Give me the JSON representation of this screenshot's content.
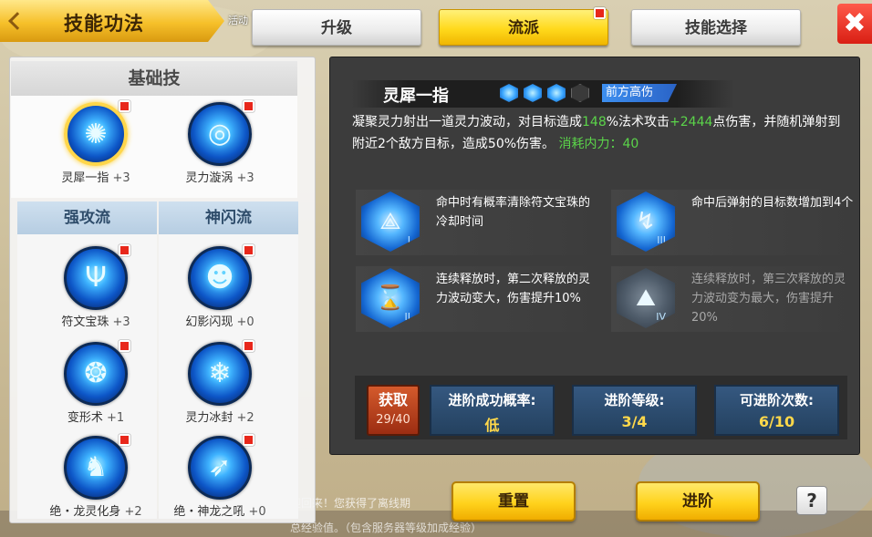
{
  "header": {
    "title": "技能功法",
    "activity_label": "活动"
  },
  "tabs": [
    {
      "label": "升级",
      "active": false
    },
    {
      "label": "流派",
      "active": true
    },
    {
      "label": "技能选择",
      "active": false
    }
  ],
  "close_glyph": "✖",
  "left": {
    "basic_header": "基础技",
    "basic_skills": [
      {
        "name": "灵犀一指",
        "level": "+3",
        "icon": "energy-orb-icon",
        "selected": true
      },
      {
        "name": "灵力漩涡",
        "level": "+3",
        "icon": "vortex-icon",
        "selected": false
      }
    ],
    "schools": [
      {
        "name": "强攻流",
        "skills": [
          {
            "name": "符文宝珠",
            "level": "+3",
            "icon": "rune-orb-icon"
          },
          {
            "name": "变形术",
            "level": "+1",
            "icon": "transform-beast-icon"
          },
          {
            "name": "绝・龙灵化身",
            "level": "+2",
            "icon": "dragon-spirit-icon"
          }
        ]
      },
      {
        "name": "神闪流",
        "skills": [
          {
            "name": "幻影闪现",
            "level": "+0",
            "icon": "phantom-blink-icon"
          },
          {
            "name": "灵力冰封",
            "level": "+2",
            "icon": "ice-crystal-icon"
          },
          {
            "name": "绝・神龙之吼",
            "level": "+0",
            "icon": "dragon-roar-icon"
          }
        ]
      }
    ]
  },
  "detail": {
    "skill_name": "灵犀一指",
    "tag": "前方高伤",
    "gems_filled": 3,
    "gems_total": 4,
    "description": {
      "p1": "凝聚灵力射出一道灵力波动，对目标造成",
      "pct": "148",
      "p2": "%法术攻击",
      "bonus": "+2444",
      "p3": "点伤害，并随机弹射到附近2个敌方目标，造成50%伤害。",
      "cost": "消耗内力：40"
    },
    "upgrades": [
      {
        "text": "命中时有概率清除符文宝珠的冷却时间",
        "roman": "I",
        "icon": "rune-hex-icon",
        "unlocked": true
      },
      {
        "text": "命中后弹射的目标数增加到4个",
        "roman": "III",
        "icon": "bounce-hex-icon",
        "unlocked": true
      },
      {
        "text": "连续释放时，第二次释放的灵力波动变大，伤害提升10%",
        "roman": "II",
        "icon": "hourglass-hex-icon",
        "unlocked": true
      },
      {
        "text": "连续释放时，第三次释放的灵力波动变为最大，伤害提升20%",
        "roman": "IV",
        "icon": "mountain-hex-icon",
        "unlocked": false
      }
    ]
  },
  "stats": {
    "acquire_label": "获取",
    "acquire_count": "29/40",
    "success_rate_label": "进阶成功概率:",
    "success_rate_value": "低",
    "level_label": "进阶等级:",
    "level_value": "3/4",
    "times_label": "可进阶次数:",
    "times_value": "6/10"
  },
  "buttons": {
    "reset": "重置",
    "advance": "进阶",
    "help": "?"
  },
  "background_msgs": {
    "line1": "迎回来！您获得了离线期",
    "line2": "总经验值。（包含服务器等级加成经验）"
  },
  "colors": {
    "accent_yellow": "#ffd21c",
    "close_red": "#d91f14",
    "highlight_green": "#5bd44a",
    "stat_value_yellow": "#ffd84a",
    "tag_blue": "#3d8ff0"
  }
}
